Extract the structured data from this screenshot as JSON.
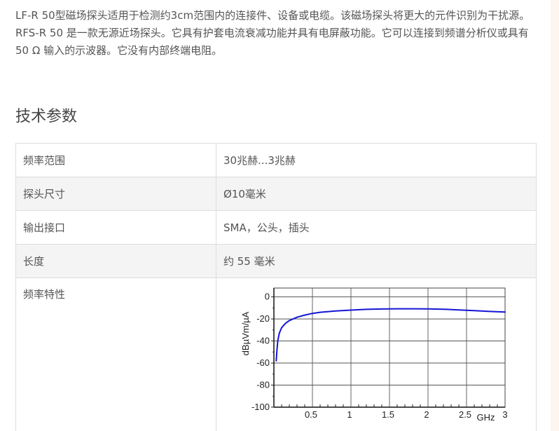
{
  "intro": {
    "paragraph1": "LF-R 50型磁场探头适用于检测约3cm范围内的连接件、设备或电缆。该磁场探头将更大的元件识别为干扰源。",
    "paragraph2": "RFS-R 50 是一款无源近场探头。它具有护套电流衰减功能并具有电屏蔽功能。它可以连接到频谱分析仪或具有 50 Ω 输入的示波器。它没有内部终端电阻。"
  },
  "section_title": "技术参数",
  "specs": [
    {
      "label": "频率范围",
      "value": "30兆赫...3兆赫"
    },
    {
      "label": "探头尺寸",
      "value": "Ø10毫米"
    },
    {
      "label": "输出接口",
      "value": "SMA，公头，插头"
    },
    {
      "label": "长度",
      "value": "约 55 毫米"
    }
  ],
  "chart_row_label": "频率特性",
  "chart_data": {
    "type": "line",
    "title": "",
    "xlabel": "GHz",
    "ylabel": "dBµVm/µA",
    "xlim": [
      0,
      3
    ],
    "ylim": [
      -100,
      8
    ],
    "xticks": [
      0.5,
      1,
      1.5,
      2,
      2.5,
      3
    ],
    "xtick_labels": [
      "0.5",
      "1",
      "1.5",
      "2",
      "2.5",
      "3"
    ],
    "yticks": [
      0,
      -20,
      -40,
      -60,
      -80,
      -100
    ],
    "ytick_labels": [
      "0",
      "-20",
      "-40",
      "-60",
      "-80",
      "-100"
    ],
    "grid": true,
    "line_color": "#1515d6",
    "series": [
      {
        "x": [
          0.03,
          0.04,
          0.05,
          0.07,
          0.1,
          0.15,
          0.2,
          0.3,
          0.4,
          0.5,
          0.6,
          0.8,
          1.0,
          1.2,
          1.4,
          1.6,
          1.8,
          2.0,
          2.2,
          2.4,
          2.6,
          2.8,
          3.0
        ],
        "y": [
          -58,
          -48,
          -40,
          -33,
          -28,
          -24,
          -21.5,
          -18.5,
          -16.5,
          -15,
          -14,
          -12.8,
          -12,
          -11.3,
          -11,
          -10.8,
          -10.8,
          -10.9,
          -11.2,
          -11.8,
          -12.5,
          -13.2,
          -13.8
        ]
      }
    ]
  }
}
